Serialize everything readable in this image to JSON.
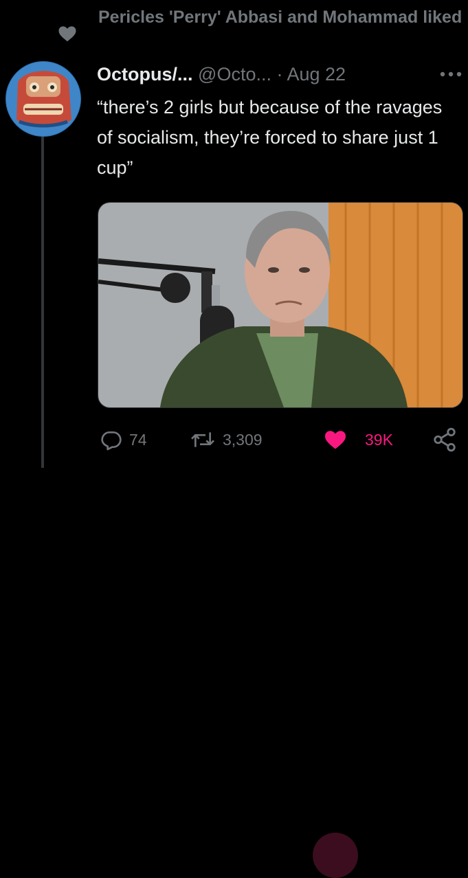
{
  "social_context": {
    "text": "Pericles 'Perry' Abbasi and Mohammad liked",
    "icon": "heart-icon"
  },
  "tweet": {
    "name": "Octopus/...",
    "handle": "@Octo...",
    "separator": "·",
    "date": "Aug 22",
    "more_icon": "more-horizontal-icon",
    "text": "“there’s 2 girls but because of the ravages of socialism, they’re forced to share just 1 cup”",
    "media_icon": "video-thumbnail"
  },
  "actions": {
    "reply": {
      "icon": "reply-icon",
      "count": "74"
    },
    "retweet": {
      "icon": "retweet-icon",
      "count": "3,309"
    },
    "like": {
      "icon": "heart-filled-icon",
      "count": "39K",
      "liked": true
    },
    "share": {
      "icon": "share-icon"
    }
  },
  "colors": {
    "background": "#000000",
    "muted": "#71767b",
    "like": "#f91880",
    "text": "#e7e9ea"
  }
}
